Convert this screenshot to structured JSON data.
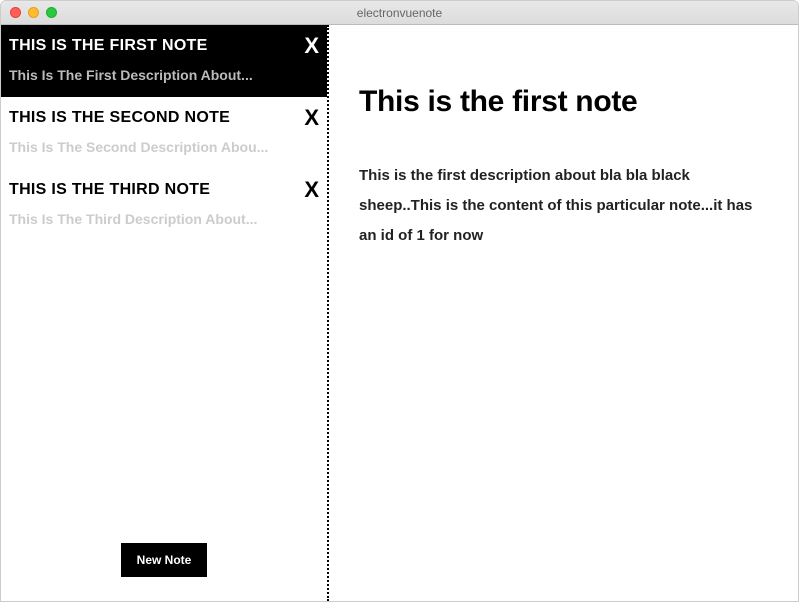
{
  "window": {
    "title": "electronvuenote"
  },
  "sidebar": {
    "newNoteLabel": "New Note",
    "notes": [
      {
        "title": "THIS IS THE FIRST NOTE",
        "description": "This Is The First Description About...",
        "active": true
      },
      {
        "title": "THIS IS THE SECOND NOTE",
        "description": "This Is The Second Description Abou...",
        "active": false
      },
      {
        "title": "THIS IS THE THIRD NOTE",
        "description": "This Is The Third Description About...",
        "active": false
      }
    ]
  },
  "content": {
    "title": "This is the first note",
    "body": "This is the first description about bla bla black sheep..This is the content of this particular note...it has an id of 1 for now"
  },
  "icons": {
    "deleteGlyph": "X"
  }
}
